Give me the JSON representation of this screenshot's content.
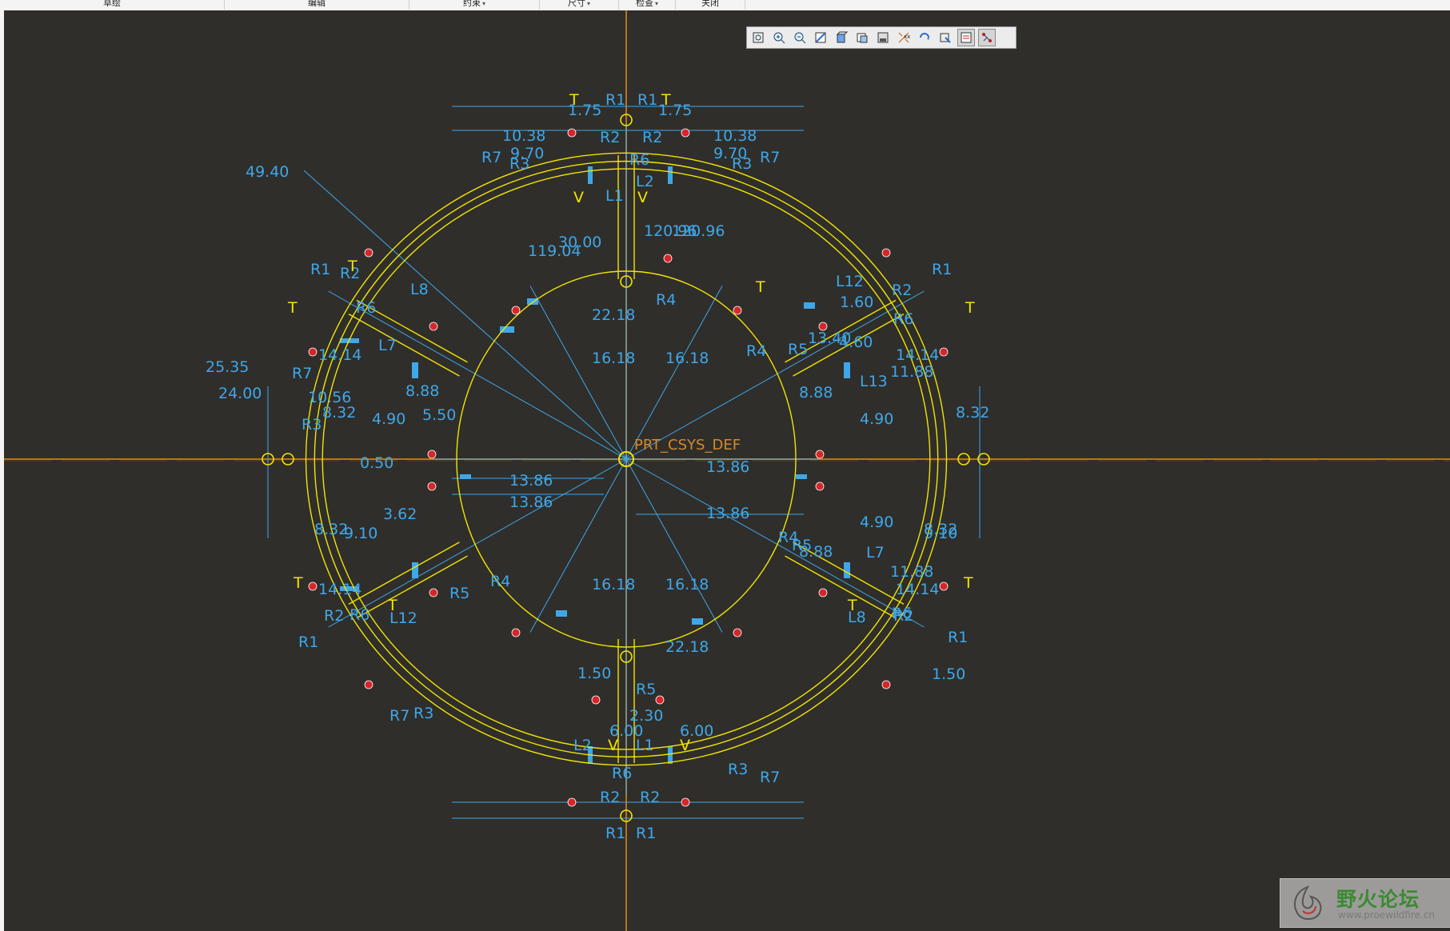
{
  "menu": [
    {
      "label": "草绘",
      "caret": false
    },
    {
      "label": "编辑",
      "caret": false
    },
    {
      "label": "约束",
      "caret": true
    },
    {
      "label": "尺寸",
      "caret": true
    },
    {
      "label": "检查",
      "caret": true
    },
    {
      "label": "关闭",
      "caret": false
    }
  ],
  "view_toolbar": [
    {
      "icon": "refit-icon",
      "active": false
    },
    {
      "icon": "zoom-in-icon",
      "active": false
    },
    {
      "icon": "zoom-out-icon",
      "active": false
    },
    {
      "icon": "repaint-icon",
      "active": false
    },
    {
      "icon": "shaded-display-icon",
      "active": false
    },
    {
      "icon": "saved-views-icon",
      "active": false
    },
    {
      "icon": "view-manager-icon",
      "active": false
    },
    {
      "icon": "datum-display-icon",
      "active": false
    },
    {
      "icon": "annotation-display-icon",
      "active": false
    },
    {
      "icon": "sketch-orientation-icon",
      "active": false
    },
    {
      "icon": "sketch-display-filter-icon",
      "active": true
    },
    {
      "icon": "constraint-display-icon",
      "active": true
    }
  ],
  "sketch": {
    "csys_label": "PRT_CSYS_DEF",
    "colors": {
      "background": "#2f2e2b",
      "geometry": "#f2e500",
      "dimension": "#3fa7e8",
      "axis": "#b8721e",
      "vertex": "#d6262a"
    },
    "dimension_labels": [
      "49.40",
      "25.35",
      "24.00",
      "10.38",
      "9.70",
      "1.75",
      "22.18",
      "16.18",
      "13.86",
      "14.14",
      "11.88",
      "10.56",
      "8.32",
      "9.10",
      "8.88",
      "4.90",
      "5.50",
      "0.50",
      "3.62",
      "6.00",
      "2.30",
      "1.50",
      "13.40",
      "4.60",
      "1.60",
      "30.00",
      "119.04",
      "120.96"
    ],
    "constraint_labels": [
      "R1",
      "R2",
      "R3",
      "R4",
      "R5",
      "R6",
      "R7",
      "L1",
      "L2",
      "L7",
      "L8",
      "L12",
      "L13",
      "T",
      "V"
    ]
  },
  "watermark": {
    "title": "野火论坛",
    "url": "www.proewildfire.cn"
  }
}
